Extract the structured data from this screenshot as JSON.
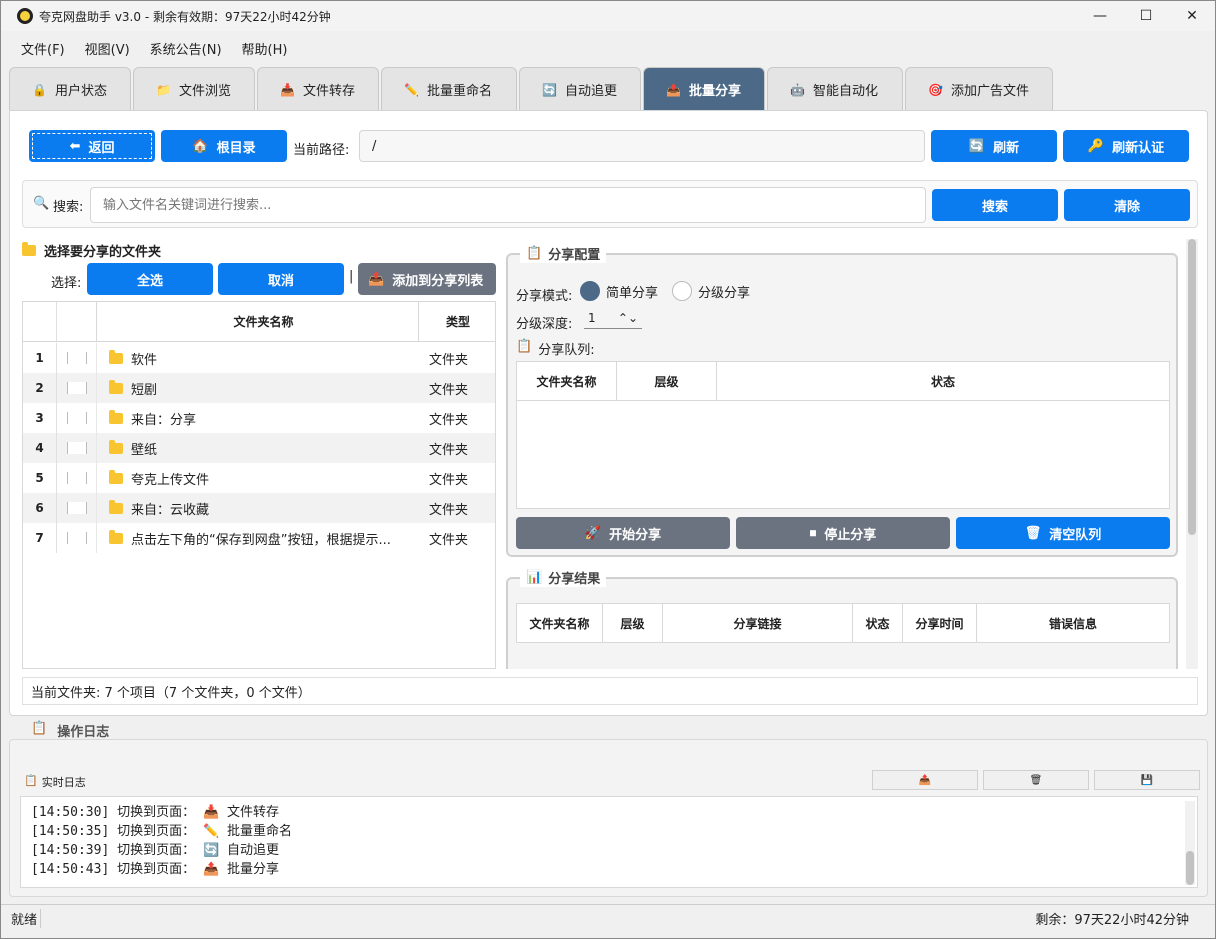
{
  "window": {
    "title": "夸克网盘助手 v3.0 - 剩余有效期：97天22小时42分钟"
  },
  "menu": [
    "文件(F)",
    "视图(V)",
    "系统公告(N)",
    "帮助(H)"
  ],
  "tabs": [
    {
      "label": "用户状态",
      "icon": "🔒"
    },
    {
      "label": "文件浏览",
      "icon": "📁"
    },
    {
      "label": "文件转存",
      "icon": "📥"
    },
    {
      "label": "批量重命名",
      "icon": "✏️"
    },
    {
      "label": "自动追更",
      "icon": "🔄"
    },
    {
      "label": "批量分享",
      "icon": "📤"
    },
    {
      "label": "智能自动化",
      "icon": "🤖"
    },
    {
      "label": "添加广告文件",
      "icon": "🎯"
    }
  ],
  "nav": {
    "back": "返回",
    "root": "根目录",
    "path_label": "当前路径:",
    "path_value": "/",
    "refresh": "刷新",
    "refresh_auth": "刷新认证"
  },
  "search": {
    "label": "搜索:",
    "placeholder": "输入文件名关键词进行搜索...",
    "search_btn": "搜索",
    "clear_btn": "清除"
  },
  "left": {
    "title": "选择要分享的文件夹",
    "select_label": "选择:",
    "select_all": "全选",
    "cancel": "取消",
    "add_queue": "添加到分享列表"
  },
  "grid": {
    "col_name": "文件夹名称",
    "col_type": "类型",
    "rows": [
      {
        "num": "1",
        "name": "软件",
        "type": "文件夹"
      },
      {
        "num": "2",
        "name": "短剧",
        "type": "文件夹"
      },
      {
        "num": "3",
        "name": "来自：分享",
        "type": "文件夹"
      },
      {
        "num": "4",
        "name": "壁纸",
        "type": "文件夹"
      },
      {
        "num": "5",
        "name": "夸克上传文件",
        "type": "文件夹"
      },
      {
        "num": "6",
        "name": "来自：云收藏",
        "type": "文件夹"
      },
      {
        "num": "7",
        "name": "点击左下角的“保存到网盘”按钮，根据提示...",
        "type": "文件夹"
      }
    ]
  },
  "config": {
    "title": "分享配置",
    "mode_label": "分享模式:",
    "mode_simple": "简单分享",
    "mode_level": "分级分享",
    "depth_label": "分级深度:",
    "depth_value": "1",
    "queue_label": "分享队列:",
    "queue_cols": [
      "文件夹名称",
      "层级",
      "状态"
    ],
    "start": "开始分享",
    "stop": "停止分享",
    "clear_queue": "清空队列"
  },
  "results": {
    "title": "分享结果",
    "cols": [
      "文件夹名称",
      "层级",
      "分享链接",
      "状态",
      "分享时间",
      "错误信息"
    ]
  },
  "status_line": "当前文件夹: 7 个项目（7 个文件夹，0 个文件）",
  "log": {
    "title": "操作日志",
    "sub": "实时日志",
    "lines": [
      {
        "time": "[14:50:30]",
        "text": "切换到页面：",
        "icon": "📥",
        "page": "文件转存"
      },
      {
        "time": "[14:50:35]",
        "text": "切换到页面：",
        "icon": "✏️",
        "page": "批量重命名"
      },
      {
        "time": "[14:50:39]",
        "text": "切换到页面：",
        "icon": "🔄",
        "page": "自动追更"
      },
      {
        "time": "[14:50:43]",
        "text": "切换到页面：",
        "icon": "📤",
        "page": "批量分享"
      }
    ]
  },
  "statusbar": {
    "left": "就绪",
    "right": "剩余：97天22小时42分钟"
  }
}
